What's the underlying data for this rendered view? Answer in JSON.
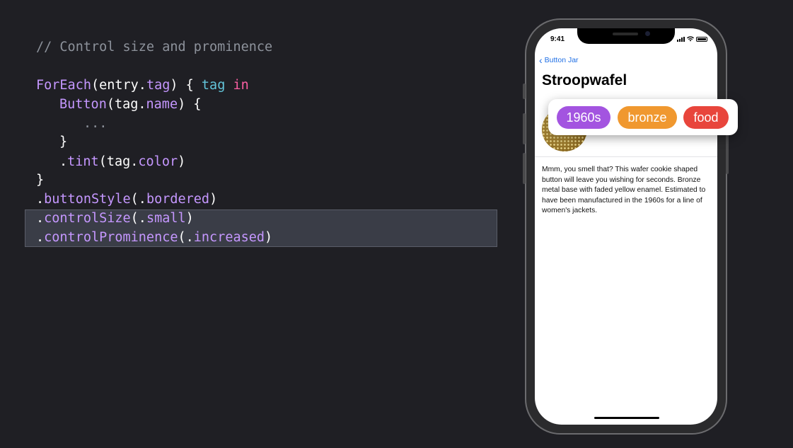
{
  "code": {
    "comment": "// Control size and prominence",
    "lines": {
      "l1": {
        "fn": "ForEach",
        "a": "(entry.",
        "b": "tag",
        "c": ") { ",
        "d": "tag",
        "e": " ",
        "f": "in"
      },
      "l2": {
        "fn": "Button",
        "a": "(tag.",
        "b": "name",
        "c": ") {"
      },
      "l3": {
        "a": "..."
      },
      "l4": {
        "a": "}"
      },
      "l5": {
        "a": ".",
        "fn": "tint",
        "b": "(tag.",
        "c": "color",
        "d": ")"
      },
      "l6": {
        "a": "}"
      },
      "l7": {
        "a": ".",
        "fn": "buttonStyle",
        "b": "(.",
        "c": "bordered",
        "d": ")"
      },
      "l8": {
        "a": ".",
        "fn": "controlSize",
        "b": "(.",
        "c": "small",
        "d": ")"
      },
      "l9": {
        "a": ".",
        "fn": "controlProminence",
        "b": "(.",
        "c": "increased",
        "d": ")"
      }
    }
  },
  "phone": {
    "time": "9:41",
    "back_label": "Button Jar",
    "title": "Stroopwafel",
    "description": "Mmm, you smell that? This wafer cookie shaped button will leave you wishing for seconds. Bronze metal base with faded yellow enamel. Estimated to have been manufactured in the 1960s for a line of women's jackets."
  },
  "tags": [
    {
      "label": "1960s",
      "color": "#a354e0"
    },
    {
      "label": "bronze",
      "color": "#f0982f"
    },
    {
      "label": "food",
      "color": "#e8453c"
    }
  ],
  "colors": {
    "background": "#1f1f24",
    "highlight": "#3a3d47",
    "link_blue": "#1f6fe5"
  }
}
